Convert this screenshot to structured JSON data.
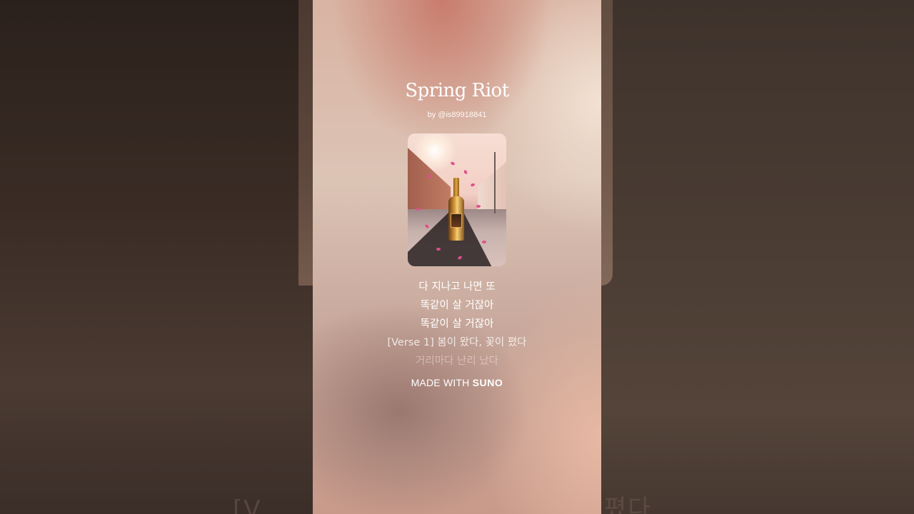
{
  "song": {
    "title": "Spring Riot",
    "artist": "by @is89918841"
  },
  "lyrics": [
    {
      "text": "다 지나고 나면 또",
      "state": "past"
    },
    {
      "text": "똑같이 살 거잖아",
      "state": "past"
    },
    {
      "text": "똑같이 살 거잖아",
      "state": "past"
    },
    {
      "text": "[Verse 1] 봄이 왔다, 꽃이 폈다",
      "state": "current"
    },
    {
      "text": "거리마다 난리 났다",
      "state": "upcoming"
    }
  ],
  "footer": {
    "made_with": "MADE WITH",
    "brand": "SUNO"
  },
  "background": {
    "ghost_left": "[V",
    "ghost_right": "폈다"
  },
  "colors": {
    "panel_top": "#d9b3a3",
    "panel_bottom": "#c89a8a",
    "side_dark": "#2b211c",
    "petal": "#e0508c"
  }
}
